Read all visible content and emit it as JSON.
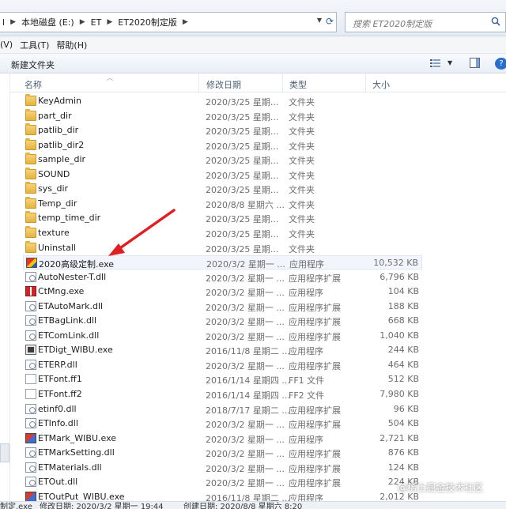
{
  "address": {
    "crumbs": [
      "本地磁盘 (E:)",
      "ET",
      "ET2020制定版"
    ],
    "left_fragment": "l"
  },
  "search": {
    "placeholder": "搜索 ET2020制定版"
  },
  "menu": [
    "(V)",
    "工具(T)",
    "帮助(H)"
  ],
  "toolbar": {
    "new_folder": "新建文件夹"
  },
  "columns": {
    "name": "名称",
    "date": "修改日期",
    "type": "类型",
    "size": "大小"
  },
  "files": [
    {
      "name": "KeyAdmin",
      "date": "2020/3/25 星期...",
      "type": "文件夹",
      "size": "",
      "icon": "folder-icon"
    },
    {
      "name": "part_dir",
      "date": "2020/3/25 星期...",
      "type": "文件夹",
      "size": "",
      "icon": "folder-icon"
    },
    {
      "name": "patlib_dir",
      "date": "2020/3/25 星期...",
      "type": "文件夹",
      "size": "",
      "icon": "folder-icon"
    },
    {
      "name": "patlib_dir2",
      "date": "2020/3/25 星期...",
      "type": "文件夹",
      "size": "",
      "icon": "folder-icon"
    },
    {
      "name": "sample_dir",
      "date": "2020/3/25 星期...",
      "type": "文件夹",
      "size": "",
      "icon": "folder-icon"
    },
    {
      "name": "SOUND",
      "date": "2020/3/25 星期...",
      "type": "文件夹",
      "size": "",
      "icon": "folder-icon"
    },
    {
      "name": "sys_dir",
      "date": "2020/3/25 星期...",
      "type": "文件夹",
      "size": "",
      "icon": "folder-icon"
    },
    {
      "name": "Temp_dir",
      "date": "2020/8/8 星期六 ...",
      "type": "文件夹",
      "size": "",
      "icon": "folder-icon"
    },
    {
      "name": "temp_time_dir",
      "date": "2020/3/25 星期...",
      "type": "文件夹",
      "size": "",
      "icon": "folder-icon"
    },
    {
      "name": "texture",
      "date": "2020/3/25 星期...",
      "type": "文件夹",
      "size": "",
      "icon": "folder-icon"
    },
    {
      "name": "Uninstall",
      "date": "2020/3/25 星期...",
      "type": "文件夹",
      "size": "",
      "icon": "folder-icon"
    },
    {
      "name": "2020高级定制.exe",
      "date": "2020/3/2 星期一 ...",
      "type": "应用程序",
      "size": "10,532 KB",
      "icon": "app-icon"
    },
    {
      "name": "AutoNester-T.dll",
      "date": "2020/3/2 星期一 ...",
      "type": "应用程序扩展",
      "size": "6,796 KB",
      "icon": "dll-icon"
    },
    {
      "name": "CtMng.exe",
      "date": "2020/3/2 星期一 ...",
      "type": "应用程序",
      "size": "104 KB",
      "icon": "app-red-icon"
    },
    {
      "name": "ETAutoMark.dll",
      "date": "2020/3/2 星期一 ...",
      "type": "应用程序扩展",
      "size": "188 KB",
      "icon": "dll-icon"
    },
    {
      "name": "ETBagLink.dll",
      "date": "2020/3/2 星期一 ...",
      "type": "应用程序扩展",
      "size": "668 KB",
      "icon": "dll-icon"
    },
    {
      "name": "ETComLink.dll",
      "date": "2020/3/2 星期一 ...",
      "type": "应用程序扩展",
      "size": "1,040 KB",
      "icon": "dll-icon"
    },
    {
      "name": "ETDigt_WIBU.exe",
      "date": "2016/11/8 星期二 ...",
      "type": "应用程序",
      "size": "244 KB",
      "icon": "exe-icon"
    },
    {
      "name": "ETERP.dll",
      "date": "2020/3/2 星期一 ...",
      "type": "应用程序扩展",
      "size": "464 KB",
      "icon": "dll-icon"
    },
    {
      "name": "ETFont.ff1",
      "date": "2016/1/14 星期四 ...",
      "type": "FF1 文件",
      "size": "512 KB",
      "icon": "file-icon"
    },
    {
      "name": "ETFont.ff2",
      "date": "2016/1/14 星期四 ...",
      "type": "FF2 文件",
      "size": "7,980 KB",
      "icon": "file-icon"
    },
    {
      "name": "etinf0.dll",
      "date": "2018/7/17 星期二 ...",
      "type": "应用程序扩展",
      "size": "96 KB",
      "icon": "dll-icon"
    },
    {
      "name": "ETInfo.dll",
      "date": "2020/3/2 星期一 ...",
      "type": "应用程序扩展",
      "size": "504 KB",
      "icon": "dll-icon"
    },
    {
      "name": "ETMark_WIBU.exe",
      "date": "2020/3/2 星期一 ...",
      "type": "应用程序",
      "size": "2,721 KB",
      "icon": "app2-icon"
    },
    {
      "name": "ETMarkSetting.dll",
      "date": "2020/3/2 星期一 ...",
      "type": "应用程序扩展",
      "size": "876 KB",
      "icon": "dll-icon"
    },
    {
      "name": "ETMaterials.dll",
      "date": "2020/3/2 星期一 ...",
      "type": "应用程序扩展",
      "size": "124 KB",
      "icon": "dll-icon"
    },
    {
      "name": "ETOut.dll",
      "date": "2020/3/2 星期一 ...",
      "type": "应用程序扩展",
      "size": "224 KB",
      "icon": "dll-icon"
    },
    {
      "name": "ETOutPut_WIBU.exe",
      "date": "2016/11/8 星期二 ...",
      "type": "应用程序",
      "size": "2,012 KB",
      "icon": "app2-icon"
    }
  ],
  "statusbar": {
    "name": "制定.exe",
    "modified": "修改日期: 2020/3/2 星期一 19:44",
    "created": "创建日期: 2020/8/8 星期六 8:20"
  },
  "watermark": "@稀土掘金技术社区",
  "colors": {
    "annotation_arrow": "#e02020",
    "selection": "#f2f6fc"
  }
}
